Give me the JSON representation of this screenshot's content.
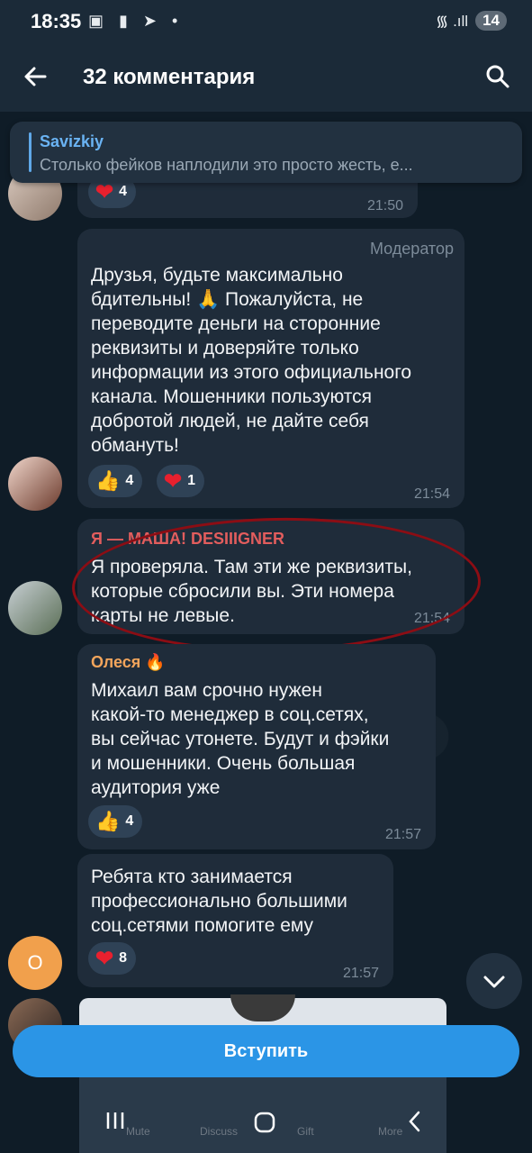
{
  "status": {
    "time": "18:35",
    "icons": "▣ ▮ ➤ •",
    "signal": "᯾ .ıll",
    "battery": "14"
  },
  "topbar": {
    "title": "32 комментария"
  },
  "pinned": {
    "name": "Savizkiy",
    "text": "Столько фейков наплодили это просто жесть, е..."
  },
  "messages": [
    {
      "reactions": [
        {
          "emoji": "heart",
          "count": "4"
        }
      ],
      "time": "21:50"
    },
    {
      "role": "Модератор",
      "text": "Друзья, будьте максимально\nбдительны! 🙏 Пожалуйста, не\nпереводите деньги на сторонние\nреквизиты и доверяйте только\nинформации из этого официального\nканала. Мошенники пользуются\nдобротой людей, не дайте себя\nобмануть!",
      "reactions": [
        {
          "emoji": "thumbs-up",
          "count": "4"
        },
        {
          "emoji": "heart",
          "count": "1"
        }
      ],
      "time": "21:54"
    },
    {
      "sender": "Я — МАША! DESIIIGNER",
      "sender_color": "#e25d5d",
      "text": "Я проверяла. Там эти же реквизиты,\nкоторые сбросили вы. Эти номера\nкарты не левые.",
      "time": "21:54"
    },
    {
      "sender": "Олеся",
      "sender_emoji": "🔥",
      "sender_color": "#f2a55c",
      "text": "Михаил вам срочно нужен\nкакой-то менеджер в соц.сетях,\nвы сейчас утонете. Будут и фэйки\nи мошенники. Очень большая\nаудитория уже",
      "reactions": [
        {
          "emoji": "thumbs-up",
          "count": "4"
        }
      ],
      "time": "21:57"
    },
    {
      "text": "Ребята кто занимается\nпрофессионально большими\nсоц.сетями помогите ему",
      "reactions": [
        {
          "emoji": "heart",
          "count": "8"
        }
      ],
      "time": "21:57",
      "avatar_letter": "О"
    }
  ],
  "join_button": "Вступить",
  "ghost_nav": [
    "Mute",
    "Discuss",
    "Gift",
    "More"
  ]
}
